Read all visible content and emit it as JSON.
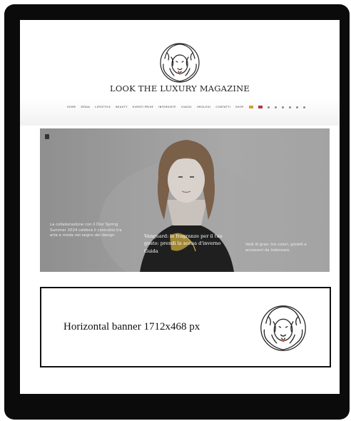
{
  "brand": {
    "name": "LOOK THE LUXURY MAGAZINE"
  },
  "nav": {
    "items": [
      "HOME",
      "MODA",
      "LIFESTYLE",
      "BEAUTY",
      "EVENTI PRIVÈ",
      "INTERVISTE",
      "VIAGGI",
      "OROLOGI",
      "CONTATTI",
      "SHOP"
    ],
    "flags": [
      {
        "name": "italian-flag",
        "color": "#c9a23a"
      },
      {
        "name": "english-flag",
        "color": "#b23a3a"
      }
    ],
    "social_icons": [
      "facebook-icon",
      "twitter-icon",
      "instagram-icon",
      "pinterest-icon",
      "youtube-icon",
      "email-icon"
    ]
  },
  "hero": {
    "left_text": "La collaborazione con il Dior Spring Summer 2024 celebra il connubio tra arte e moda nel segno del design.",
    "center_title": "Vanguard: le fragranze per il tuo gusto: prendi la scena d'inverno Guida",
    "right_text": "Vedi di gran: tre colori, gioielli e accessori da indossare."
  },
  "banner": {
    "label": "Horizontal banner 1712x468 px"
  },
  "colors": {
    "frame": "#0b0b0b",
    "hero_gray": "#9d9d9d",
    "accent_gold": "#c9a23a"
  }
}
